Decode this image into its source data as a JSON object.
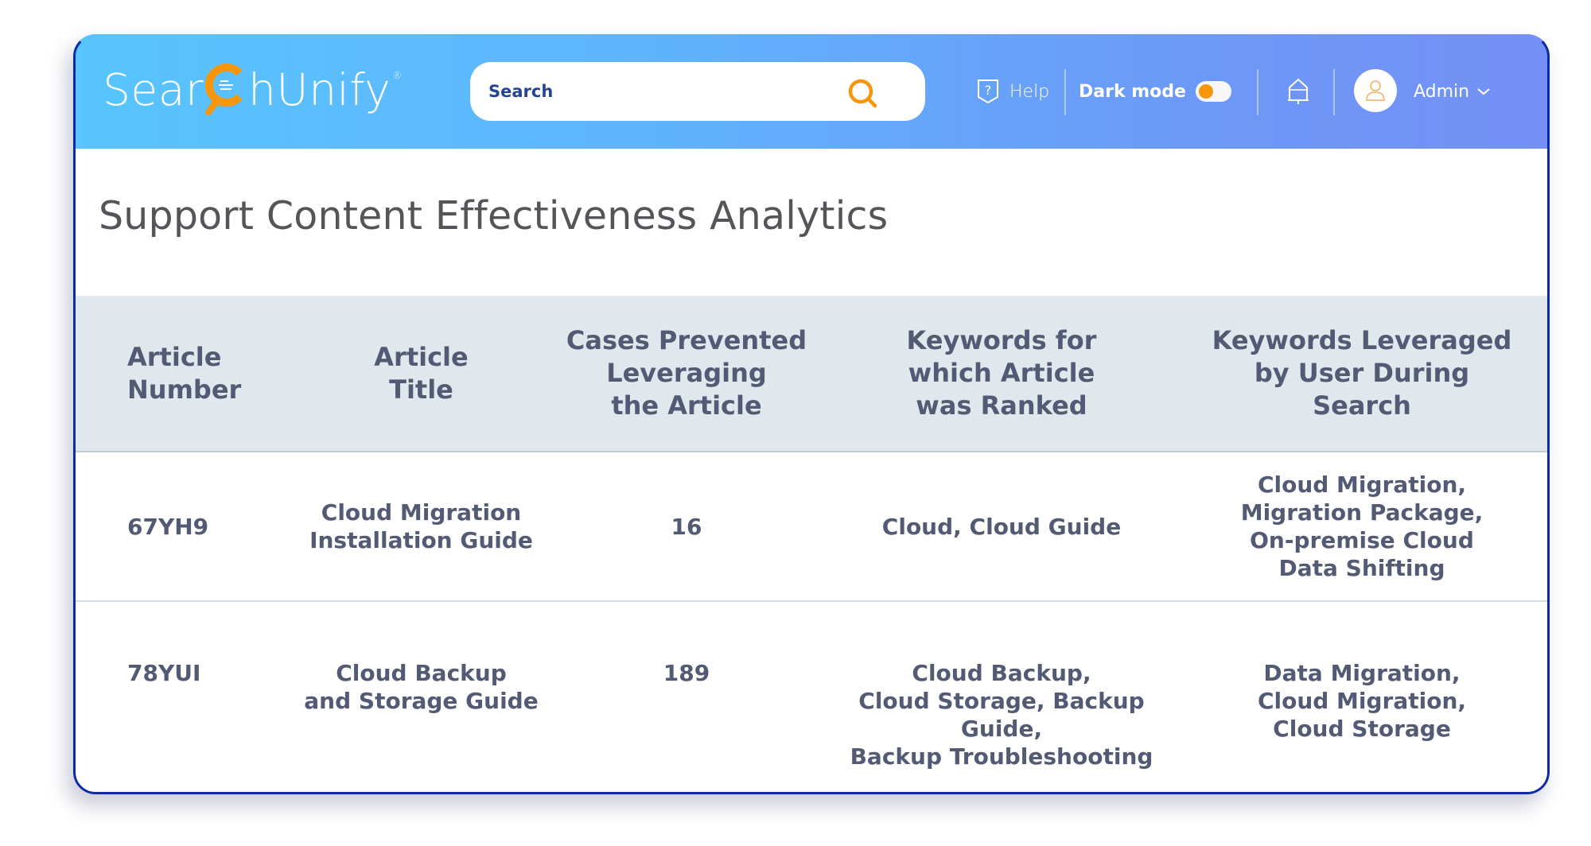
{
  "app": {
    "logo_text_left": "Sear",
    "logo_text_right": "hUnify",
    "logo_mark": "®"
  },
  "header": {
    "search_placeholder": "Search",
    "search_value": "",
    "help_label": "Help",
    "dark_mode_label": "Dark mode",
    "dark_mode_on": false,
    "user_label": "Admin",
    "icons": {
      "help": "help-shield-icon",
      "search": "search-icon",
      "notifications": "bell-icon",
      "avatar": "user-icon",
      "dropdown": "chevron-down-icon"
    },
    "colors": {
      "accent": "#f7960b",
      "gradient_start": "#58c5fd",
      "gradient_end": "#7490f6",
      "border": "#0f2aa5"
    }
  },
  "page": {
    "title": "Support Content Effectiveness Analytics"
  },
  "table": {
    "columns": [
      "Article\nNumber",
      "Article\nTitle",
      "Cases Prevented\nLeveraging\nthe Article",
      "Keywords for\nwhich Article\nwas Ranked",
      "Keywords Leveraged\nby User During\nSearch"
    ],
    "rows": [
      {
        "article_number": "67YH9",
        "article_title": "Cloud Migration\nInstallation Guide",
        "cases_prevented": "16",
        "keywords_ranked": "Cloud, Cloud Guide",
        "keywords_leveraged": "Cloud Migration,\nMigration Package,\nOn-premise Cloud\nData Shifting"
      },
      {
        "article_number": "78YUI",
        "article_title": "Cloud Backup\nand Storage Guide",
        "cases_prevented": "189",
        "keywords_ranked": "Cloud Backup,\nCloud Storage, Backup Guide,\nBackup Troubleshooting",
        "keywords_leveraged": "Data Migration,\nCloud Migration,\nCloud Storage"
      }
    ]
  }
}
